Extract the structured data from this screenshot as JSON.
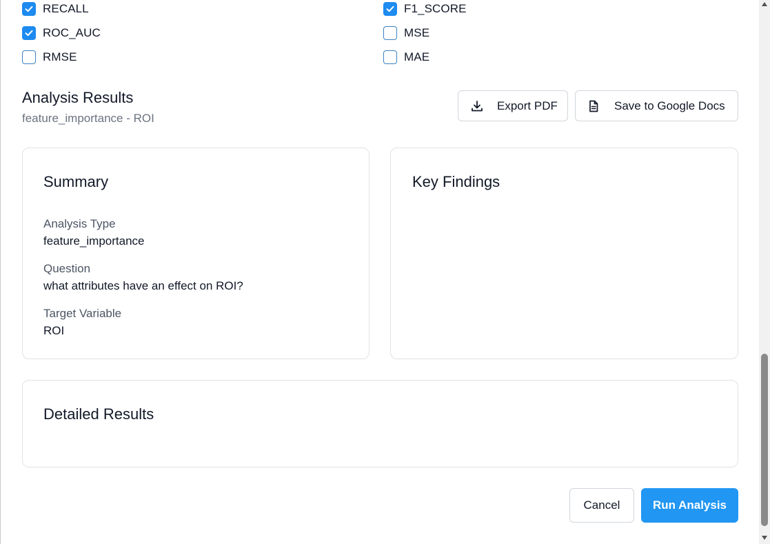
{
  "metrics": [
    {
      "label": "RECALL",
      "checked": true
    },
    {
      "label": "F1_SCORE",
      "checked": true
    },
    {
      "label": "ROC_AUC",
      "checked": true
    },
    {
      "label": "MSE",
      "checked": false
    },
    {
      "label": "RMSE",
      "checked": false
    },
    {
      "label": "MAE",
      "checked": false
    }
  ],
  "results": {
    "title": "Analysis Results",
    "subtitle": "feature_importance - ROI",
    "export_pdf_label": "Export PDF",
    "save_docs_label": "Save to Google Docs"
  },
  "summary": {
    "title": "Summary",
    "analysis_type_label": "Analysis Type",
    "analysis_type_value": "feature_importance",
    "question_label": "Question",
    "question_value": "what attributes have an effect on ROI?",
    "target_label": "Target Variable",
    "target_value": "ROI"
  },
  "key_findings": {
    "title": "Key Findings"
  },
  "detailed_results": {
    "title": "Detailed Results"
  },
  "footer": {
    "cancel_label": "Cancel",
    "run_label": "Run Analysis"
  },
  "colors": {
    "accent": "#2196f3",
    "checkbox": "#1d8bf0"
  }
}
